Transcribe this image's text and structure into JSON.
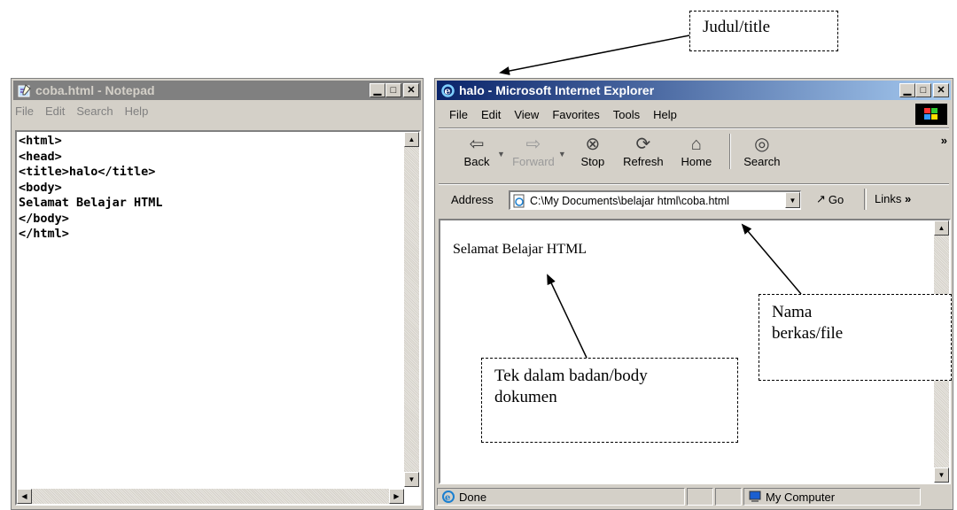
{
  "notepad": {
    "title": "coba.html - Notepad",
    "menu": [
      "File",
      "Edit",
      "Search",
      "Help"
    ],
    "code_lines": [
      "<html>",
      "<head>",
      "<title>halo</title>",
      "<body>",
      "Selamat Belajar HTML",
      "</body>",
      "</html>"
    ]
  },
  "ie": {
    "title": "halo - Microsoft Internet Explorer",
    "menu": [
      "File",
      "Edit",
      "View",
      "Favorites",
      "Tools",
      "Help"
    ],
    "toolbar": {
      "back": "Back",
      "forward": "Forward",
      "stop": "Stop",
      "refresh": "Refresh",
      "home": "Home",
      "search": "Search"
    },
    "address_label": "Address",
    "address_value": "C:\\My Documents\\belajar html\\coba.html",
    "go_label": "Go",
    "links_label": "Links",
    "page_text": "Selamat Belajar HTML",
    "status_text": "Done",
    "zone_text": "My Computer"
  },
  "callouts": {
    "title": "Judul/title",
    "file_line1": "Nama",
    "file_line2": "berkas/file",
    "body_line1": "Tek dalam badan/body",
    "body_line2": "dokumen"
  },
  "colors": {
    "active_title_start": "#0a246a",
    "active_title_end": "#a6caf0",
    "inactive_title": "#808080",
    "chrome": "#d4d0c8"
  }
}
